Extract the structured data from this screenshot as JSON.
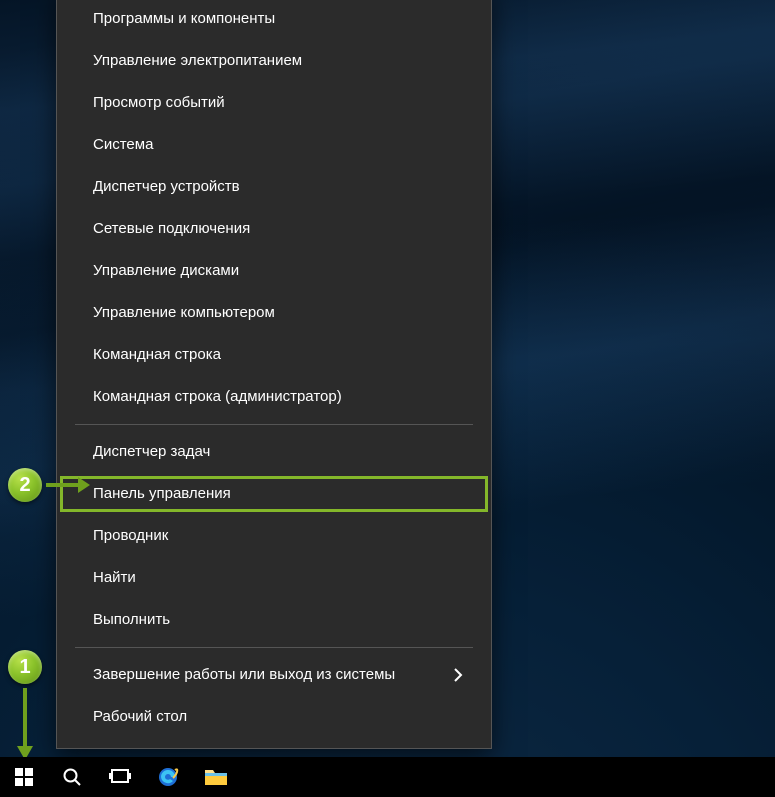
{
  "annotations": {
    "step1": "1",
    "step2": "2"
  },
  "menu": {
    "groups": [
      [
        "Программы и компоненты",
        "Управление электропитанием",
        "Просмотр событий",
        "Система",
        "Диспетчер устройств",
        "Сетевые подключения",
        "Управление дисками",
        "Управление компьютером",
        "Командная строка",
        "Командная строка (администратор)"
      ],
      [
        "Диспетчер задач",
        "Панель управления",
        "Проводник",
        "Найти",
        "Выполнить"
      ],
      [
        "Завершение работы или выход из системы",
        "Рабочий стол"
      ]
    ],
    "highlighted": "Панель управления",
    "hasSubmenu": "Завершение работы или выход из системы"
  },
  "taskbar": {
    "start": "start",
    "search": "search",
    "taskview": "task-view",
    "ie": "internet-explorer",
    "explorer": "file-explorer"
  },
  "colors": {
    "accent": "#84b72a",
    "menuBg": "#2b2b2b",
    "taskbarBg": "#000000"
  }
}
